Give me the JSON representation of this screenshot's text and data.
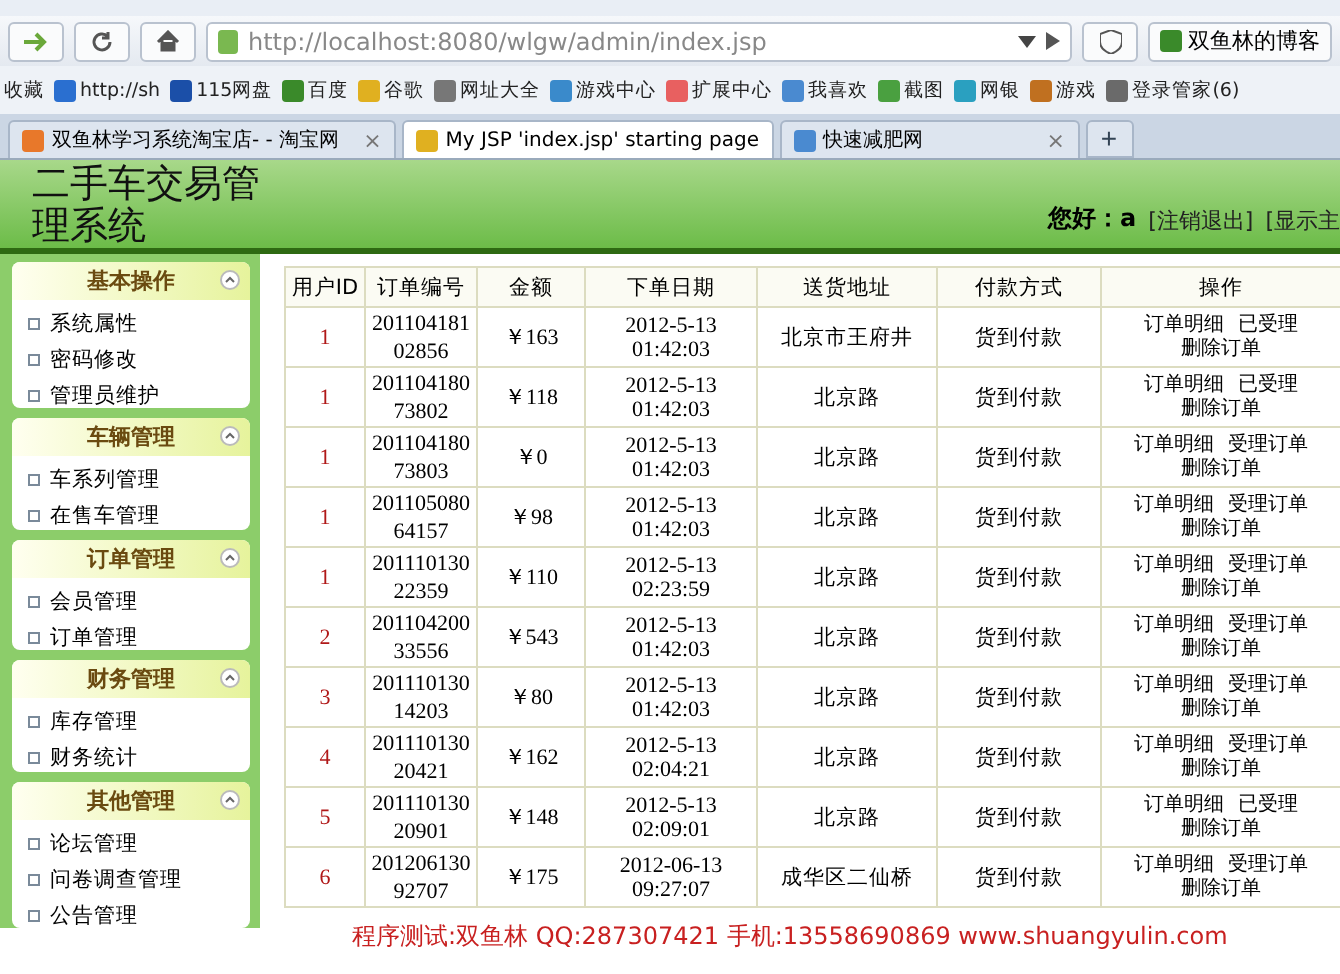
{
  "browser": {
    "url": "http://localhost:8080/wlgw/admin/index.jsp",
    "account_button": "双鱼林的博客",
    "bookmarks": [
      {
        "label": "收藏"
      },
      {
        "label": "http://sh"
      },
      {
        "label": "115网盘"
      },
      {
        "label": "百度"
      },
      {
        "label": "谷歌"
      },
      {
        "label": "网址大全"
      },
      {
        "label": "游戏中心"
      },
      {
        "label": "扩展中心"
      },
      {
        "label": "我喜欢"
      },
      {
        "label": "截图"
      },
      {
        "label": "网银"
      },
      {
        "label": "游戏"
      },
      {
        "label": "登录管家(6)"
      }
    ],
    "tabs": [
      {
        "label": "双鱼林学习系统淘宝店- - 淘宝网",
        "selected": false,
        "close": "×"
      },
      {
        "label": "My JSP 'index.jsp' starting page",
        "selected": true
      },
      {
        "label": "快速减肥网",
        "selected": false,
        "close": "×"
      }
    ],
    "new_tab": "+"
  },
  "header": {
    "title_lines": [
      "二手车交易管",
      "理系统"
    ],
    "greeting": "您好：",
    "user": "a",
    "links": [
      "[注销退出]",
      "[显示主"
    ]
  },
  "sidebar": {
    "groups": [
      {
        "title": "基本操作",
        "items": [
          "系统属性",
          "密码修改",
          "管理员维护"
        ]
      },
      {
        "title": "车辆管理",
        "items": [
          "车系列管理",
          "在售车管理"
        ]
      },
      {
        "title": "订单管理",
        "items": [
          "会员管理",
          "订单管理"
        ]
      },
      {
        "title": "财务管理",
        "items": [
          "库存管理",
          "财务统计"
        ]
      },
      {
        "title": "其他管理",
        "items": [
          "论坛管理",
          "问卷调查管理",
          "公告管理"
        ]
      }
    ]
  },
  "table": {
    "columns": [
      "用户ID",
      "订单编号",
      "金额",
      "下单日期",
      "送货地址",
      "付款方式",
      "操作"
    ],
    "rows": [
      {
        "user_id": "1",
        "order_no": "20110418102856",
        "amount": "￥163",
        "date": "2012-5-13 01:42:03",
        "address": "北京市王府井",
        "payment": "货到付款",
        "actions": [
          "订单明细",
          "已受理",
          "删除订单"
        ]
      },
      {
        "user_id": "1",
        "order_no": "20110418073802",
        "amount": "￥118",
        "date": "2012-5-13 01:42:03",
        "address": "北京路",
        "payment": "货到付款",
        "actions": [
          "订单明细",
          "已受理",
          "删除订单"
        ]
      },
      {
        "user_id": "1",
        "order_no": "20110418073803",
        "amount": "￥0",
        "date": "2012-5-13 01:42:03",
        "address": "北京路",
        "payment": "货到付款",
        "actions": [
          "订单明细",
          "受理订单",
          "删除订单"
        ]
      },
      {
        "user_id": "1",
        "order_no": "20110508064157",
        "amount": "￥98",
        "date": "2012-5-13 01:42:03",
        "address": "北京路",
        "payment": "货到付款",
        "actions": [
          "订单明细",
          "受理订单",
          "删除订单"
        ]
      },
      {
        "user_id": "1",
        "order_no": "20111013022359",
        "amount": "￥110",
        "date": "2012-5-13 02:23:59",
        "address": "北京路",
        "payment": "货到付款",
        "actions": [
          "订单明细",
          "受理订单",
          "删除订单"
        ]
      },
      {
        "user_id": "2",
        "order_no": "20110420033556",
        "amount": "￥543",
        "date": "2012-5-13 01:42:03",
        "address": "北京路",
        "payment": "货到付款",
        "actions": [
          "订单明细",
          "受理订单",
          "删除订单"
        ]
      },
      {
        "user_id": "3",
        "order_no": "20111013014203",
        "amount": "￥80",
        "date": "2012-5-13 01:42:03",
        "address": "北京路",
        "payment": "货到付款",
        "actions": [
          "订单明细",
          "受理订单",
          "删除订单"
        ]
      },
      {
        "user_id": "4",
        "order_no": "20111013020421",
        "amount": "￥162",
        "date": "2012-5-13 02:04:21",
        "address": "北京路",
        "payment": "货到付款",
        "actions": [
          "订单明细",
          "受理订单",
          "删除订单"
        ]
      },
      {
        "user_id": "5",
        "order_no": "20111013020901",
        "amount": "￥148",
        "date": "2012-5-13 02:09:01",
        "address": "北京路",
        "payment": "货到付款",
        "actions": [
          "订单明细",
          "已受理",
          "删除订单"
        ]
      },
      {
        "user_id": "6",
        "order_no": "20120613092707",
        "amount": "￥175",
        "date": "2012-06-13 09:27:07",
        "address": "成华区二仙桥",
        "payment": "货到付款",
        "actions": [
          "订单明细",
          "受理订单",
          "删除订单"
        ]
      }
    ]
  },
  "footer": "程序测试:双鱼林 QQ:287307421 手机:13558690869 www.shuangyulin.com"
}
